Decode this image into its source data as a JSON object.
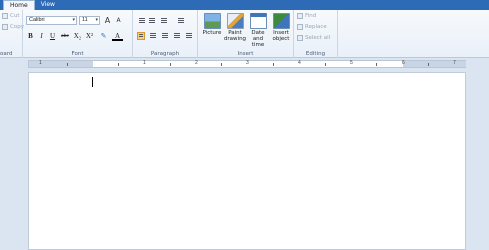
{
  "tabs": [
    {
      "label": "Home"
    },
    {
      "label": "View"
    }
  ],
  "clipboard": {
    "cut": "Cut",
    "copy": "Copy",
    "group_label": "oard"
  },
  "font": {
    "family": "Calibri",
    "size": "11",
    "group_label": "Font",
    "bold": "B",
    "italic": "I",
    "underline": "U",
    "strike": "abc",
    "subscript": "X₂",
    "superscript": "X²",
    "grow": "A",
    "shrink": "A",
    "font_color": "A"
  },
  "paragraph": {
    "group_label": "Paragraph"
  },
  "insert": {
    "group_label": "Insert",
    "picture": "Picture",
    "paint_1": "Paint",
    "paint_2": "drawing",
    "date_1": "Date and",
    "date_2": "time",
    "object_1": "Insert",
    "object_2": "object"
  },
  "editing": {
    "group_label": "Editing",
    "find": "Find",
    "replace": "Replace",
    "select_all": "Select all"
  },
  "ruler": {
    "numbers": [
      "1",
      "1",
      "2",
      "3",
      "4",
      "5",
      "6",
      "7"
    ]
  }
}
